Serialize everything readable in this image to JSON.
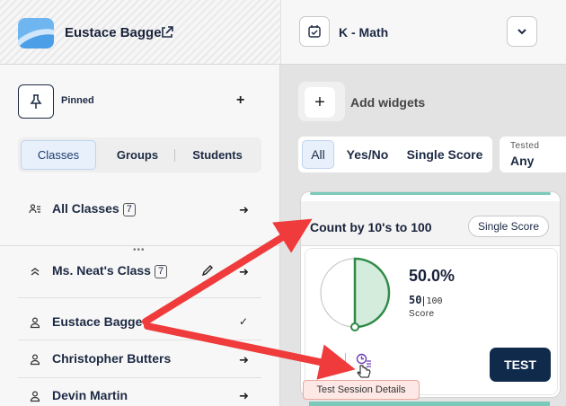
{
  "header": {
    "user_name": "Eustace Bagge",
    "subject": "K - Math"
  },
  "sidebar": {
    "pinned_label": "Pinned",
    "tabs": [
      {
        "label": "Classes",
        "active": true
      },
      {
        "label": "Groups",
        "active": false
      },
      {
        "label": "Students",
        "active": false
      }
    ],
    "all_classes": {
      "label": "All Classes",
      "count": "7"
    },
    "class": {
      "label": "Ms. Neat's Class",
      "count": "7"
    },
    "students": [
      {
        "name": "Eustace Bagge",
        "selected": true
      },
      {
        "name": "Christopher Butters",
        "selected": false
      },
      {
        "name": "Devin Martin",
        "selected": false
      }
    ]
  },
  "toolbar": {
    "add_widgets_label": "Add widgets"
  },
  "filter": {
    "options": [
      "All",
      "Yes/No",
      "Single Score"
    ],
    "selected": "All",
    "tested_label": "Tested",
    "tested_value": "Any"
  },
  "widget": {
    "title": "Count by 10's to 100",
    "type_badge": "Single Score",
    "percent": "50.0%",
    "progress": 0.5,
    "score": "50",
    "max": "100",
    "score_label": "Score",
    "test_button": "TEST"
  },
  "tooltip": {
    "text": "Test Session Details"
  },
  "colors": {
    "accent": "#7bc9ba",
    "progress_fill": "#d3ecdc",
    "progress_stroke": "#2e8b46",
    "navy": "#102a4c",
    "arrow": "#ef3b3b"
  }
}
